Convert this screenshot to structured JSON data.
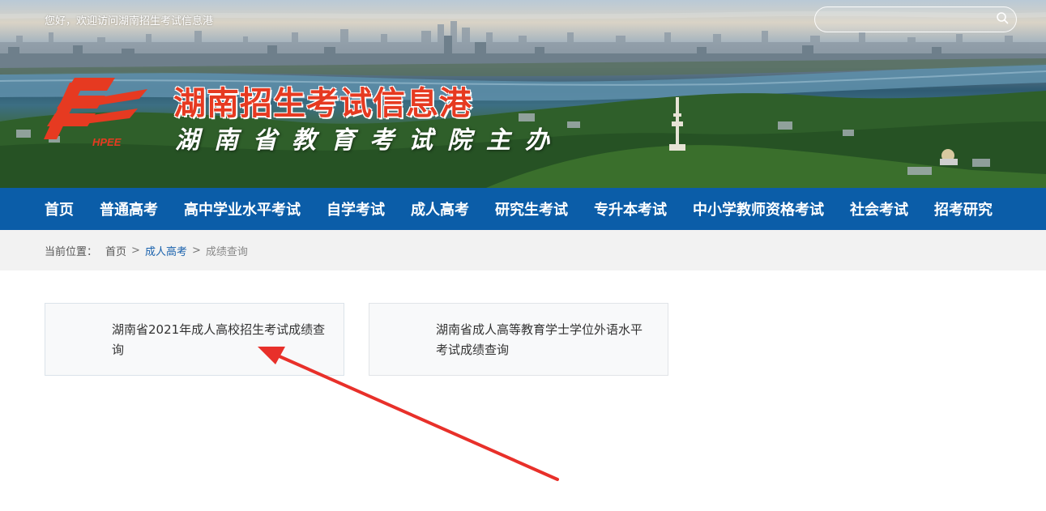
{
  "header": {
    "welcome": "您好，欢迎访问湖南招生考试信息港",
    "search_placeholder": "",
    "site_title": "湖南招生考试信息港",
    "site_subtitle": "湖南省教育考试院主办",
    "logo_text": "HPEE"
  },
  "nav": {
    "items": [
      {
        "label": "首页"
      },
      {
        "label": "普通高考"
      },
      {
        "label": "高中学业水平考试"
      },
      {
        "label": "自学考试"
      },
      {
        "label": "成人高考"
      },
      {
        "label": "研究生考试"
      },
      {
        "label": "专升本考试"
      },
      {
        "label": "中小学教师资格考试"
      },
      {
        "label": "社会考试"
      },
      {
        "label": "招考研究"
      }
    ]
  },
  "breadcrumb": {
    "prefix": "当前位置：",
    "home": "首页",
    "separator": ">",
    "section": "成人高考",
    "current": "成绩查询"
  },
  "cards": [
    {
      "title": "湖南省2021年成人高校招生考试成绩查询"
    },
    {
      "title": "湖南省成人高等教育学士学位外语水平考试成绩查询"
    }
  ],
  "colors": {
    "nav_bg": "#0b5da8",
    "title_red": "#e63a21",
    "breadcrumb_bg": "#f2f2f2",
    "link_blue": "#1a62ad",
    "annotation_arrow": "#e8302a"
  }
}
